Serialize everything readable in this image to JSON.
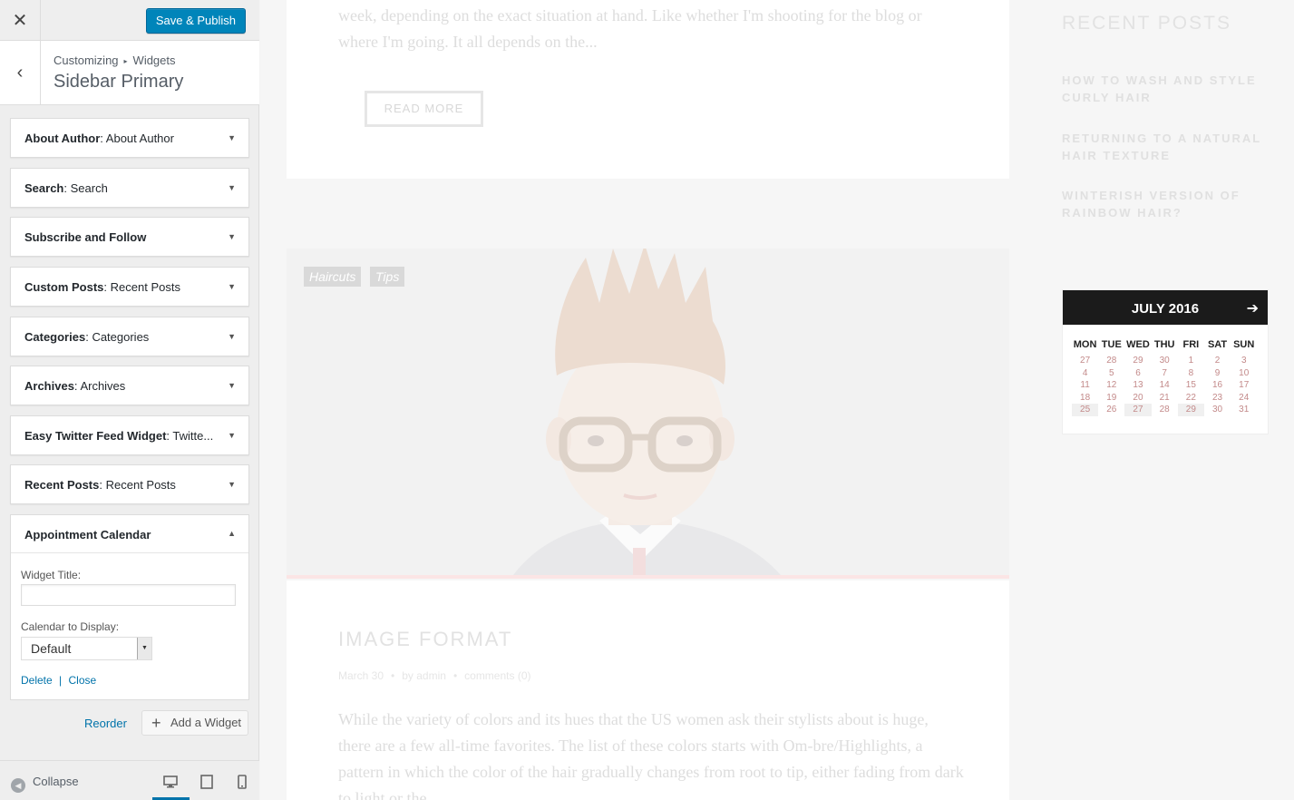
{
  "customizer": {
    "save_label": "Save & Publish",
    "breadcrumb_root": "Customizing",
    "breadcrumb_section": "Widgets",
    "section_title": "Sidebar Primary",
    "widgets": [
      {
        "name": "About Author",
        "title": "About Author"
      },
      {
        "name": "Search",
        "title": "Search"
      },
      {
        "name": "Subscribe and Follow",
        "title": ""
      },
      {
        "name": "Custom Posts",
        "title": "Recent Posts"
      },
      {
        "name": "Categories",
        "title": "Categories"
      },
      {
        "name": "Archives",
        "title": "Archives"
      },
      {
        "name": "Easy Twitter Feed Widget",
        "title": "Twitte..."
      },
      {
        "name": "Recent Posts",
        "title": "Recent Posts"
      }
    ],
    "open_widget": {
      "name": "Appointment Calendar",
      "title_label": "Widget Title:",
      "title_value": "",
      "calendar_label": "Calendar to Display:",
      "calendar_value": "Default",
      "delete_label": "Delete",
      "separator": "|",
      "close_label": "Close"
    },
    "reorder_label": "Reorder",
    "add_widget_label": "Add a Widget",
    "collapse_label": "Collapse"
  },
  "preview": {
    "excerpt1": "week, depending on the exact situation at hand. Like whether I'm shooting for the blog or where I'm going. It all depends on the...",
    "read_more": "READ MORE",
    "tags": [
      "Haircuts",
      "Tips"
    ],
    "post2": {
      "title": "IMAGE FORMAT",
      "date": "March 30",
      "author": "by admin",
      "comments": "comments (0)",
      "excerpt": "While the variety of colors and its hues that the US women ask their stylists about is huge, there are a few all-time favorites. The list of these colors starts with Om-bre/Highlights, a pattern in which the color of the hair gradually changes from root to tip, either fading from dark to light or the..."
    },
    "recent_posts": {
      "title": "RECENT POSTS",
      "items": [
        "HOW TO WASH AND STYLE CURLY HAIR",
        "RETURNING TO A NATURAL HAIR TEXTURE",
        "WINTERISH VERSION OF RAINBOW HAIR?"
      ]
    },
    "calendar": {
      "month": "JULY 2016",
      "days_of_week": [
        "MON",
        "TUE",
        "WED",
        "THU",
        "FRI",
        "SAT",
        "SUN"
      ],
      "weeks": [
        [
          "27",
          "28",
          "29",
          "30",
          "1",
          "2",
          "3"
        ],
        [
          "4",
          "5",
          "6",
          "7",
          "8",
          "9",
          "10"
        ],
        [
          "11",
          "12",
          "13",
          "14",
          "15",
          "16",
          "17"
        ],
        [
          "18",
          "19",
          "20",
          "21",
          "22",
          "23",
          "24"
        ],
        [
          "25",
          "26",
          "27",
          "28",
          "29",
          "30",
          "31"
        ]
      ]
    }
  },
  "colors": {
    "primary_button": "#0085ba",
    "link": "#0073aa",
    "calendar_header": "#1b1b1b",
    "calendar_day": "#c38a8a"
  },
  "icons": {
    "close": "close-icon",
    "back": "chevron-left-icon",
    "expand": "caret-down-icon",
    "collapse": "caret-up-icon",
    "add": "plus-icon",
    "desktop": "desktop-icon",
    "tablet": "tablet-icon",
    "mobile": "mobile-icon",
    "next": "arrow-right-icon"
  }
}
